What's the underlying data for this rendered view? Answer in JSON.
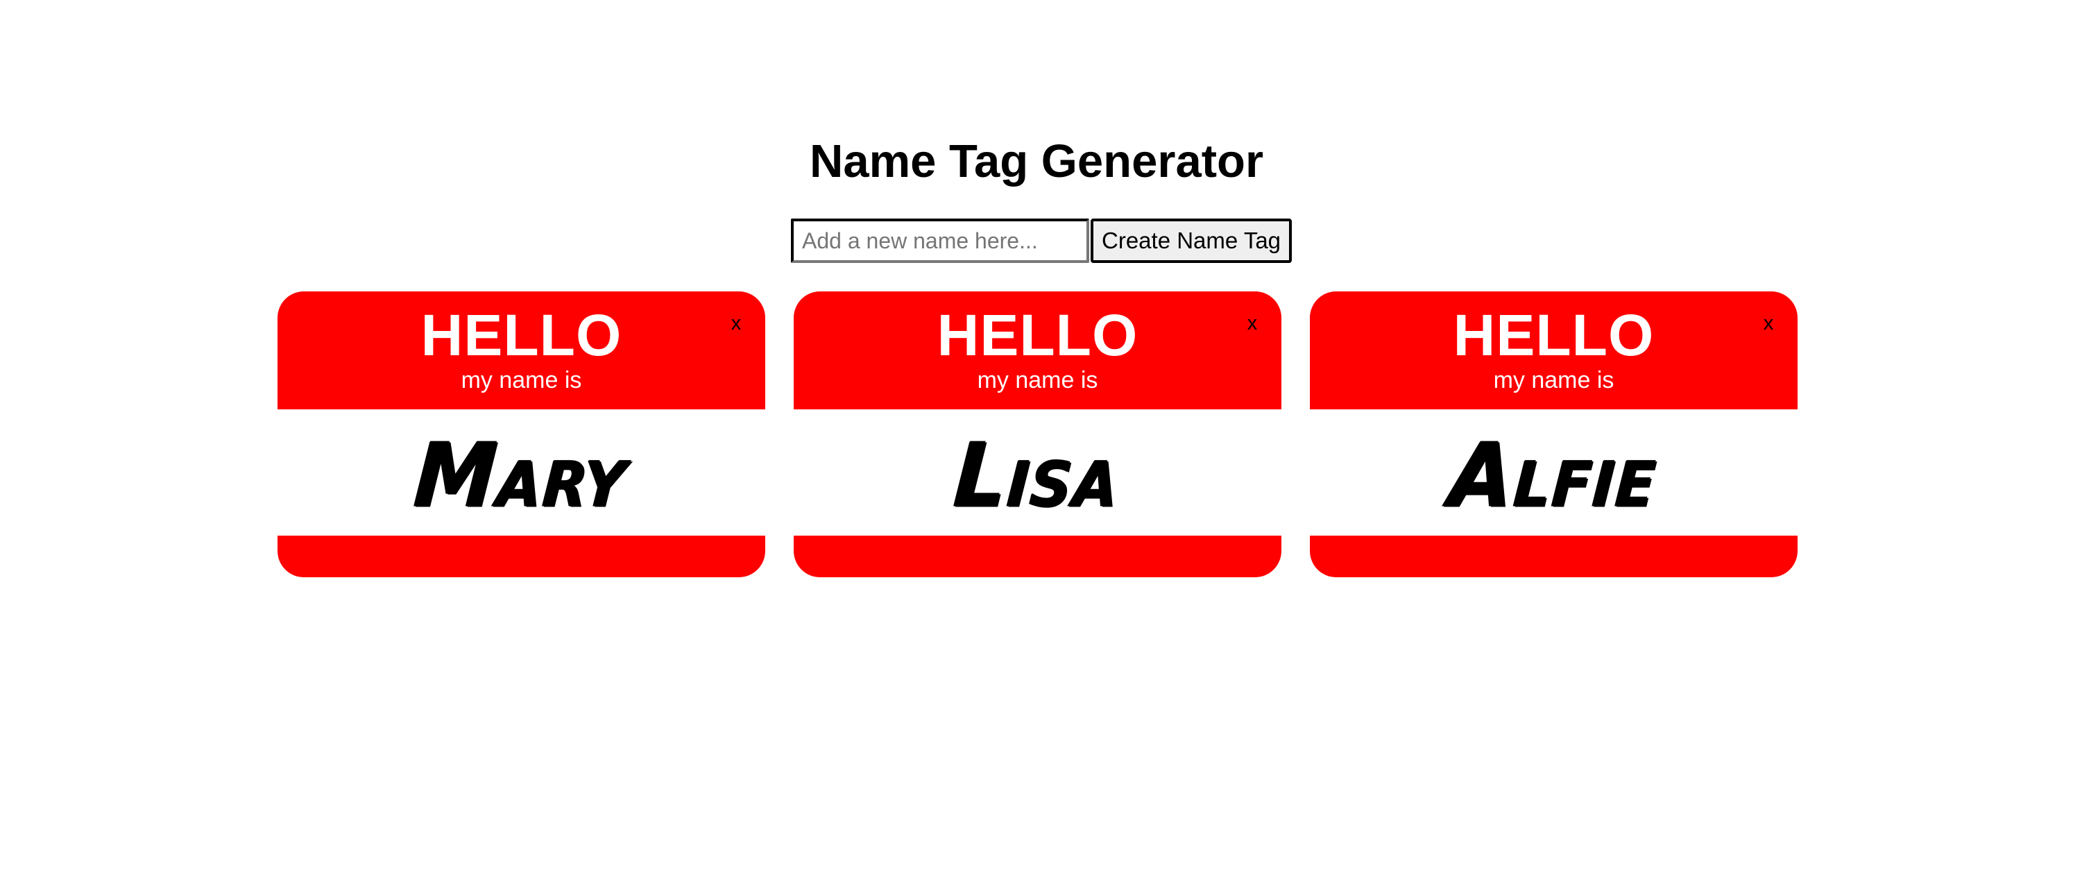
{
  "page": {
    "title": "Name Tag Generator"
  },
  "form": {
    "placeholder": "Add a new name here...",
    "value": "",
    "button_label": "Create Name Tag"
  },
  "tag_template": {
    "greeting": "HELLO",
    "subtitle": "my name is",
    "close_label": "x"
  },
  "tags": [
    {
      "name": "Mary"
    },
    {
      "name": "Lisa"
    },
    {
      "name": "Alfie"
    }
  ],
  "colors": {
    "tag_red": "#ff0000",
    "tag_text": "#ffffff",
    "name_text": "#000000"
  }
}
